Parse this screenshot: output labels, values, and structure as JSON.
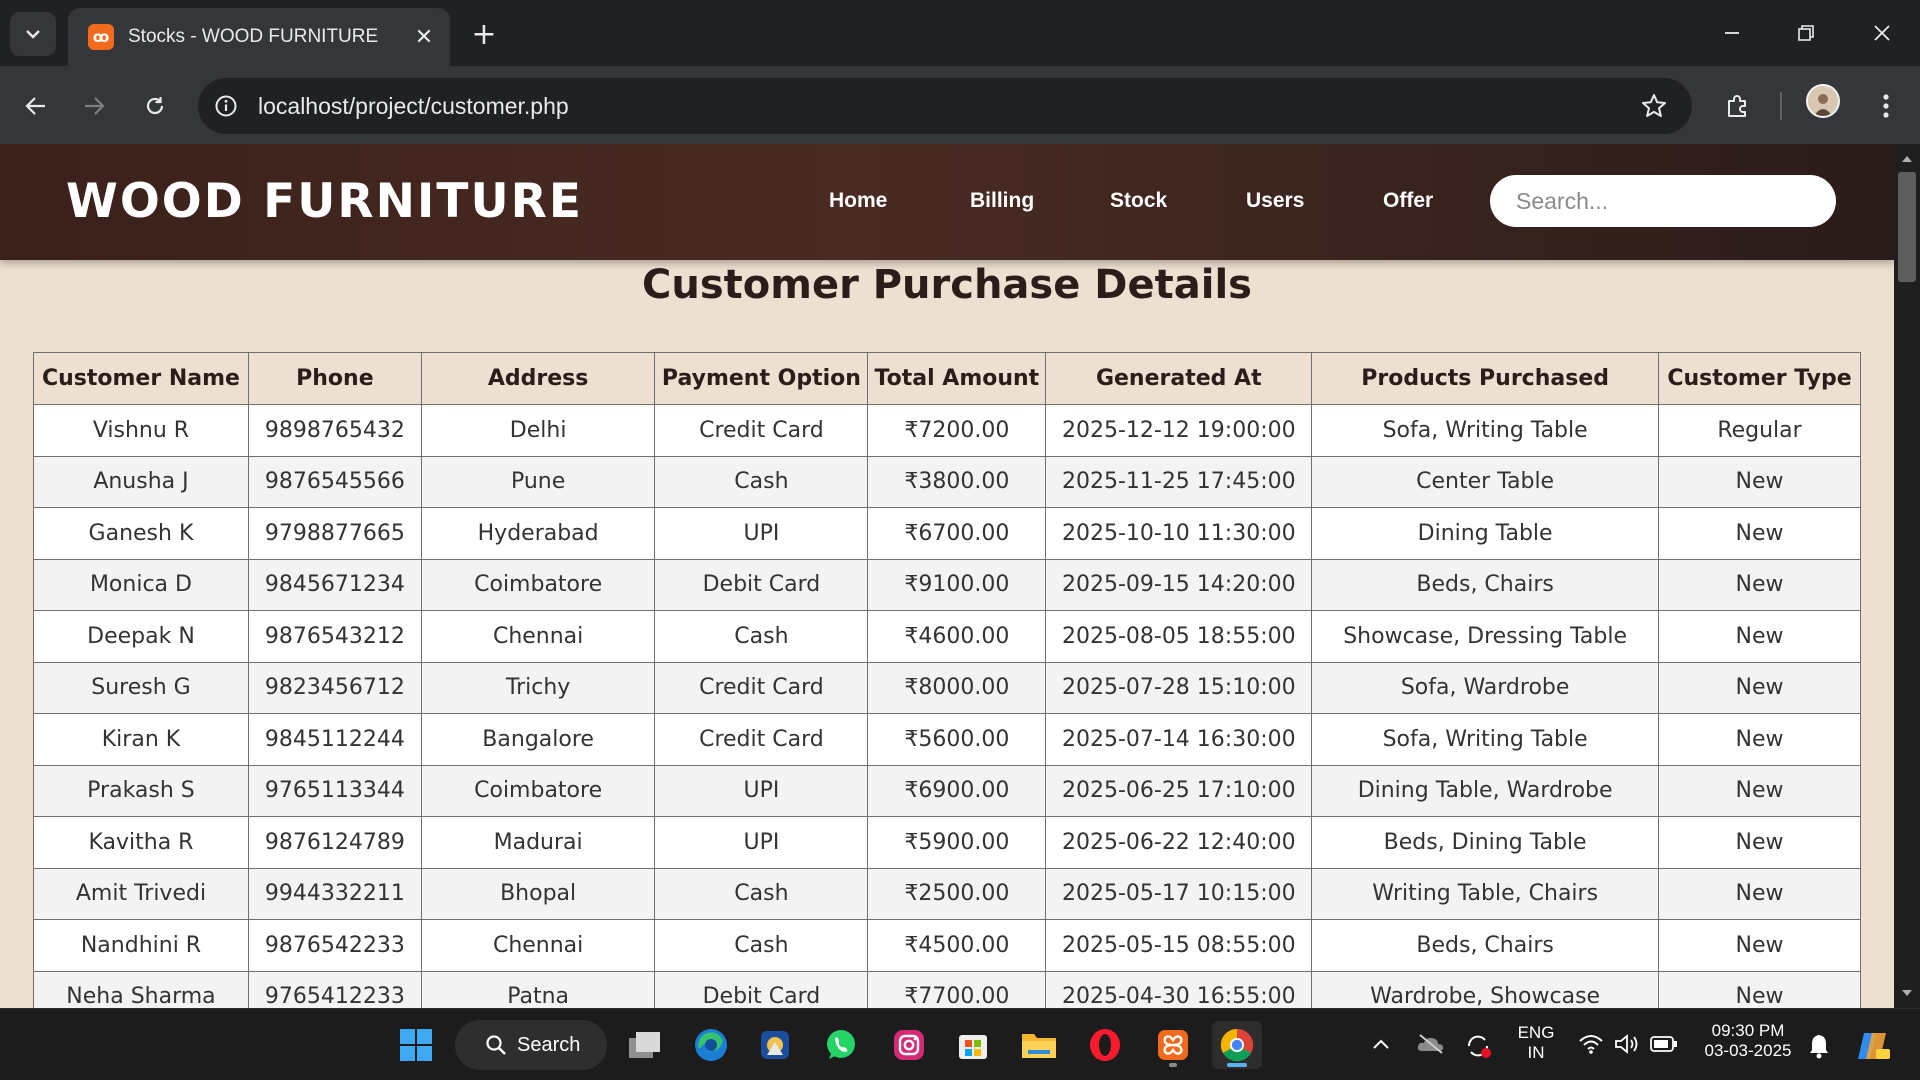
{
  "browser": {
    "tab_title": "Stocks - WOOD FURNITURE",
    "tab_close": "✕",
    "new_tab": "+",
    "url": "localhost/project/customer.php"
  },
  "site": {
    "logo": "WOOD FURNITURE",
    "nav": [
      "Home",
      "Billing",
      "Stock",
      "Users",
      "Offer"
    ],
    "search_placeholder": "Search...",
    "page_title": "Customer Purchase Details"
  },
  "table": {
    "columns": [
      "Customer Name",
      "Phone",
      "Address",
      "Payment Option",
      "Total Amount",
      "Generated At",
      "Products Purchased",
      "Customer Type"
    ],
    "rows": [
      [
        "Vishnu R",
        "9898765432",
        "Delhi",
        "Credit Card",
        "₹7200.00",
        "2025-12-12 19:00:00",
        "Sofa, Writing Table",
        "Regular"
      ],
      [
        "Anusha J",
        "9876545566",
        "Pune",
        "Cash",
        "₹3800.00",
        "2025-11-25 17:45:00",
        "Center Table",
        "New"
      ],
      [
        "Ganesh K",
        "9798877665",
        "Hyderabad",
        "UPI",
        "₹6700.00",
        "2025-10-10 11:30:00",
        "Dining Table",
        "New"
      ],
      [
        "Monica D",
        "9845671234",
        "Coimbatore",
        "Debit Card",
        "₹9100.00",
        "2025-09-15 14:20:00",
        "Beds, Chairs",
        "New"
      ],
      [
        "Deepak N",
        "9876543212",
        "Chennai",
        "Cash",
        "₹4600.00",
        "2025-08-05 18:55:00",
        "Showcase, Dressing Table",
        "New"
      ],
      [
        "Suresh G",
        "9823456712",
        "Trichy",
        "Credit Card",
        "₹8000.00",
        "2025-07-28 15:10:00",
        "Sofa, Wardrobe",
        "New"
      ],
      [
        "Kiran K",
        "9845112244",
        "Bangalore",
        "Credit Card",
        "₹5600.00",
        "2025-07-14 16:30:00",
        "Sofa, Writing Table",
        "New"
      ],
      [
        "Prakash S",
        "9765113344",
        "Coimbatore",
        "UPI",
        "₹6900.00",
        "2025-06-25 17:10:00",
        "Dining Table, Wardrobe",
        "New"
      ],
      [
        "Kavitha R",
        "9876124789",
        "Madurai",
        "UPI",
        "₹5900.00",
        "2025-06-22 12:40:00",
        "Beds, Dining Table",
        "New"
      ],
      [
        "Amit Trivedi",
        "9944332211",
        "Bhopal",
        "Cash",
        "₹2500.00",
        "2025-05-17 10:15:00",
        "Writing Table, Chairs",
        "New"
      ],
      [
        "Nandhini R",
        "9876542233",
        "Chennai",
        "Cash",
        "₹4500.00",
        "2025-05-15 08:55:00",
        "Beds, Chairs",
        "New"
      ],
      [
        "Neha Sharma",
        "9765412233",
        "Patna",
        "Debit Card",
        "₹7700.00",
        "2025-04-30 16:55:00",
        "Wardrobe, Showcase",
        "New"
      ]
    ]
  },
  "taskbar": {
    "search_label": "Search",
    "apps": [
      "file-explorer-icon",
      "edge-icon",
      "photos-icon",
      "whatsapp-icon",
      "instagram-icon",
      "store-icon",
      "folder-icon",
      "opera-icon",
      "xampp-icon",
      "chrome-icon"
    ],
    "lang_top": "ENG",
    "lang_bottom": "IN",
    "time": "09:30 PM",
    "date": "03-03-2025"
  },
  "colors": {
    "page_bg": "#ede0d0",
    "header_bg": "#3a201b",
    "title_text": "#2b1d1a"
  }
}
